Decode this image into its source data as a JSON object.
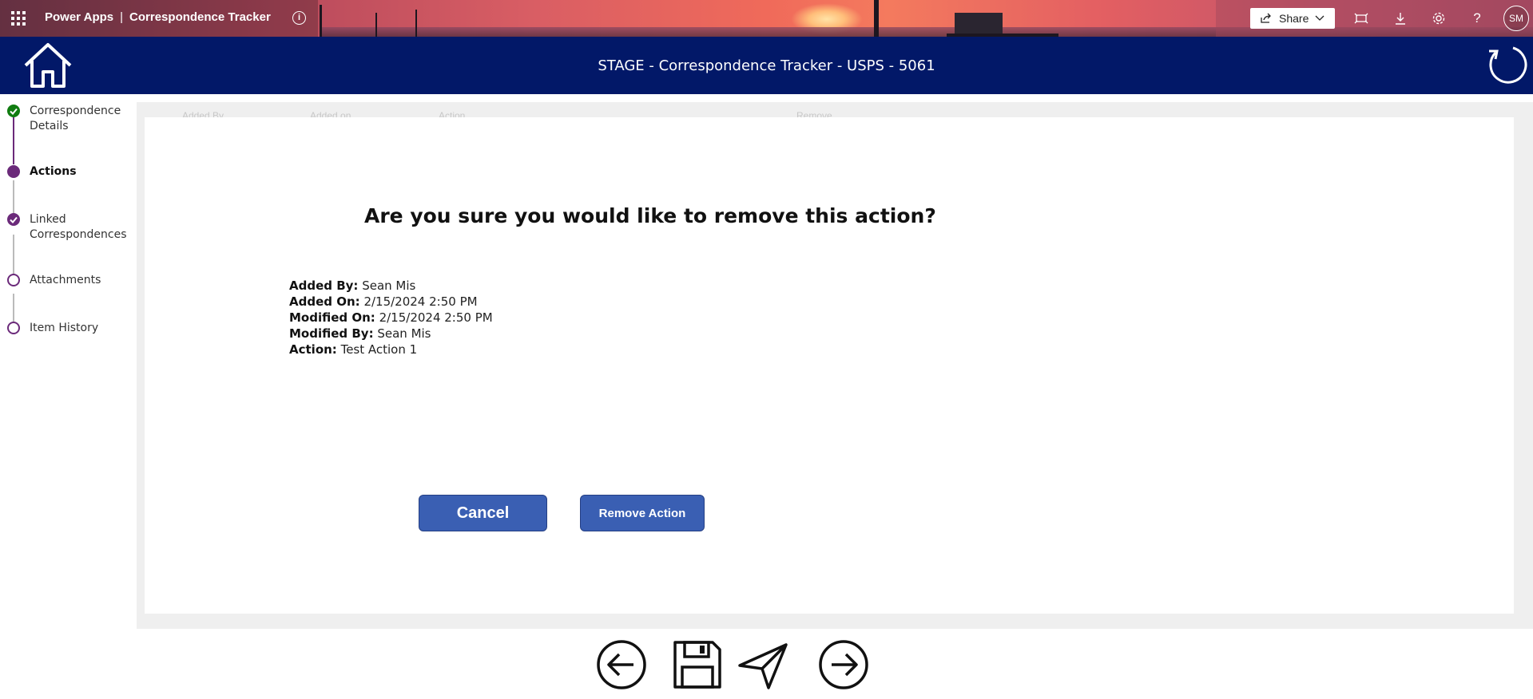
{
  "suitebar": {
    "app_name": "Power Apps",
    "separator": "|",
    "app_title": "Correspondence Tracker",
    "share_label": "Share",
    "avatar_initials": "SM",
    "icons": [
      "waffle-icon",
      "info-icon",
      "share-icon",
      "chevron-down-icon",
      "fit-screen-icon",
      "download-icon",
      "settings-icon",
      "help-icon"
    ]
  },
  "header": {
    "title": "STAGE - Correspondence Tracker  - USPS - 5061",
    "background": "#021868",
    "icons": [
      "home-icon",
      "refresh-icon"
    ]
  },
  "stepnav": {
    "accent": "#6b2a7a",
    "done_color": "#107c10",
    "items": [
      {
        "label": "Correspondence Details",
        "state": "completed"
      },
      {
        "label": "Actions",
        "state": "current"
      },
      {
        "label": "Linked Correspondences",
        "state": "completed"
      },
      {
        "label": "Attachments",
        "state": "pending"
      },
      {
        "label": "Item History",
        "state": "pending"
      }
    ]
  },
  "background_table": {
    "headers": [
      "Added By",
      "Added on",
      "Action",
      "Remove"
    ]
  },
  "dialog": {
    "title": "Are you sure you would like to remove this action?",
    "fields": [
      {
        "label": "Added By:",
        "value": "Sean Mis"
      },
      {
        "label": "Added On:",
        "value": "2/15/2024 2:50 PM"
      },
      {
        "label": "Modified On:",
        "value": "2/15/2024 2:50 PM"
      },
      {
        "label": "Modified By:",
        "value": "Sean Mis"
      },
      {
        "label": "Action:",
        "value": "Test Action 1"
      }
    ],
    "cancel_label": "Cancel",
    "remove_label": "Remove Action",
    "button_color": "#3a5fb3"
  },
  "bottom_toolbar": {
    "icons": [
      "back-arrow-icon",
      "save-icon",
      "send-icon",
      "forward-arrow-icon"
    ]
  }
}
